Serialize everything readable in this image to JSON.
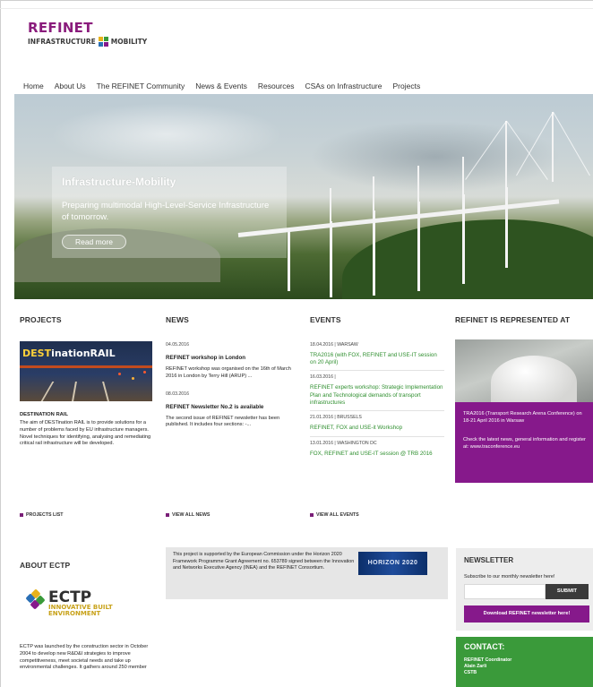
{
  "brand": {
    "name": "REFINET",
    "tagline_left": "INFRASTRUCTURE",
    "tagline_right": "MOBILITY",
    "colors": {
      "purple": "#86198b",
      "green": "#3a9a3a"
    }
  },
  "nav": {
    "items": [
      "Home",
      "About Us",
      "The REFINET Community",
      "News & Events",
      "Resources",
      "CSAs on Infrastructure",
      "Projects"
    ]
  },
  "hero": {
    "title": "Infrastructure-Mobility",
    "text": "Preparing multimodal High-Level-Service Infrastructure of tomorrow.",
    "button": "Read more"
  },
  "projects": {
    "heading": "PROJECTS",
    "image_label_a": "DEST",
    "image_label_b": "inationRAIL",
    "title": "DESTINATION RAIL",
    "text": "The aim of DESTination RAIL is to provide solutions for a number of problems faced by EU infrastructure managers. Novel techniques for identifying, analysing and remediating critical rail infrastructure will be developed.",
    "more": "PROJECTS LIST"
  },
  "news": {
    "heading": "NEWS",
    "items": [
      {
        "date": "04.05.2016",
        "title": "REFINET workshop in London",
        "text": "REFINET workshop was organised on the 16th of March 2016 in London by Terry Hill (ARUP) ..."
      },
      {
        "date": "08.03.2016",
        "title": "REFINET Newsletter No.2 is available",
        "text": "The second issue of REFINET newsletter has been published. It includes four sections: -..."
      }
    ],
    "more": "VIEW ALL NEWS"
  },
  "events": {
    "heading": "EVENTS",
    "items": [
      {
        "date": "18.04.2016 | WARSAW",
        "title": "TRA2016 (with FOX, REFINET and USE-IT session on 20 April)"
      },
      {
        "date": "16.03.2016 |",
        "title": "REFINET experts workshop: Strategic Implementation Plan and Technological demands of transport infrastructures"
      },
      {
        "date": "21.01.2016 | BRUSSELS",
        "title": "REFINET, FOX and USE-it Workshop"
      },
      {
        "date": "13.01.2016 | WASHINGTON DC",
        "title": "FOX, REFINET and USE-IT session @ TRB 2016"
      }
    ],
    "more": "VIEW ALL EVENTS"
  },
  "represented": {
    "heading": "REFINET IS REPRESENTED AT",
    "text1": "TRA2016 (Transport Research Arena Conference) on 18-21 April 2016 in Warsaw",
    "text2": "Check the latest news, general information and register at: www.traconference.eu"
  },
  "about": {
    "heading": "ABOUT ECTP",
    "logo_word": "ECTP",
    "logo_tag1": "INNOVATIVE BUILT",
    "logo_tag2": "ENVIRONMENT",
    "text": "ECTP was launched by the construction sector in October 2004 to develop new R&D&I strategies to improve competitiveness, meet societal needs and take up environmental challenges. It gathers around 250 member"
  },
  "eu": {
    "text": "This project is supported by the European Commission under the Horizon 2020 Framework Programme Grant Agreement no. 653789 signed between the Innovation and Networks Executive Agency (INEA) and the REFINET Consortium.",
    "image_label": "HORIZON 2020"
  },
  "newsletter": {
    "heading": "NEWSLETTER",
    "sub": "Subscribe to our monthly newsletter here!",
    "submit": "SUBMIT",
    "download": "Download REFINET newsletter here!"
  },
  "contact": {
    "heading": "CONTACT:",
    "line1": "REFINET Coordinator",
    "line2": "Alain Zarli",
    "line3": "CSTB"
  }
}
